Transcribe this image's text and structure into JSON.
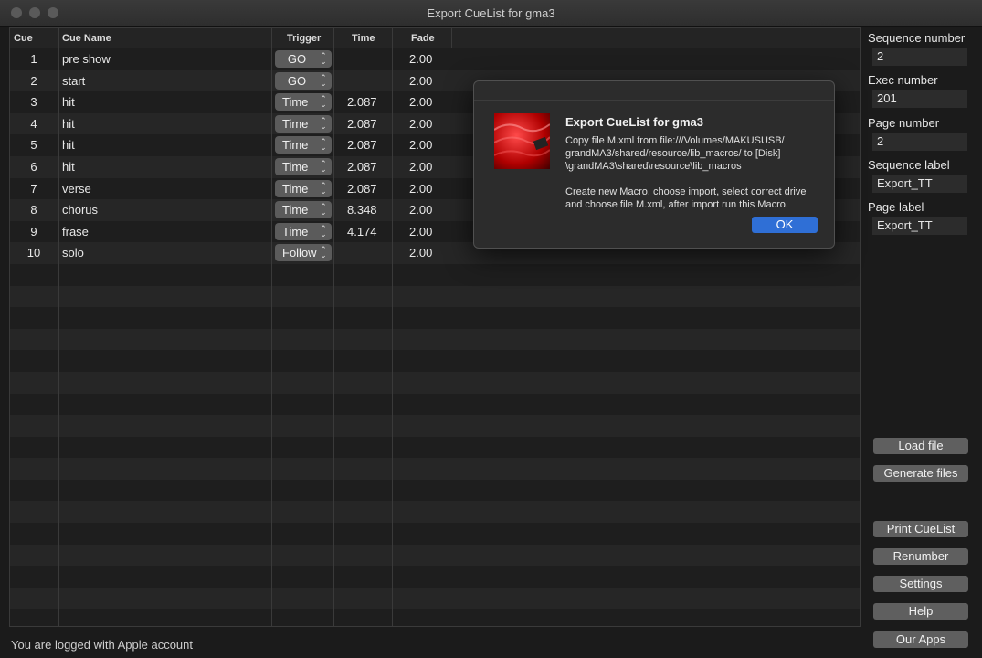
{
  "window": {
    "title": "Export CueList for gma3"
  },
  "table": {
    "headers": {
      "cue": "Cue",
      "name": "Cue Name",
      "trigger": "Trigger",
      "time": "Time",
      "fade": "Fade"
    },
    "rows": [
      {
        "cue": "1",
        "name": "pre show",
        "trigger": "GO",
        "time": "",
        "fade": "2.00"
      },
      {
        "cue": "2",
        "name": "start",
        "trigger": "GO",
        "time": "",
        "fade": "2.00"
      },
      {
        "cue": "3",
        "name": "hit",
        "trigger": "Time",
        "time": "2.087",
        "fade": "2.00"
      },
      {
        "cue": "4",
        "name": "hit",
        "trigger": "Time",
        "time": "2.087",
        "fade": "2.00"
      },
      {
        "cue": "5",
        "name": "hit",
        "trigger": "Time",
        "time": "2.087",
        "fade": "2.00"
      },
      {
        "cue": "6",
        "name": "hit",
        "trigger": "Time",
        "time": "2.087",
        "fade": "2.00"
      },
      {
        "cue": "7",
        "name": "verse",
        "trigger": "Time",
        "time": "2.087",
        "fade": "2.00"
      },
      {
        "cue": "8",
        "name": "chorus",
        "trigger": "Time",
        "time": "8.348",
        "fade": "2.00"
      },
      {
        "cue": "9",
        "name": "frase",
        "trigger": "Time",
        "time": "4.174",
        "fade": "2.00"
      },
      {
        "cue": "10",
        "name": "solo",
        "trigger": "Follow",
        "time": "",
        "fade": "2.00"
      }
    ]
  },
  "sidebar": {
    "sequence_number_label": "Sequence number",
    "sequence_number": "2",
    "exec_number_label": "Exec number",
    "exec_number": "201",
    "page_number_label": "Page number",
    "page_number": "2",
    "sequence_label_label": "Sequence label",
    "sequence_label": "Export_TT",
    "page_label_label": "Page label",
    "page_label": "Export_TT",
    "buttons": {
      "load_file": "Load file",
      "generate_files": "Generate files",
      "print_cuelist": "Print CueList",
      "renumber": "Renumber",
      "settings": "Settings",
      "help": "Help",
      "our_apps": "Our Apps"
    }
  },
  "status": {
    "text": "You are logged with Apple account"
  },
  "dialog": {
    "title": "Export CueList for gma3",
    "message": "Copy file M.xml from file:///Volumes/MAKUSUSB/\ngrandMA3/shared/resource/lib_macros/ to [Disk]\n\\grandMA3\\shared\\resource\\lib_macros\n\nCreate new Macro, choose import, select correct drive\nand choose file M.xml, after import run this Macro.",
    "ok_label": "OK"
  },
  "colors": {
    "accent": "#2f6fd6",
    "background": "#1b1b1b"
  }
}
